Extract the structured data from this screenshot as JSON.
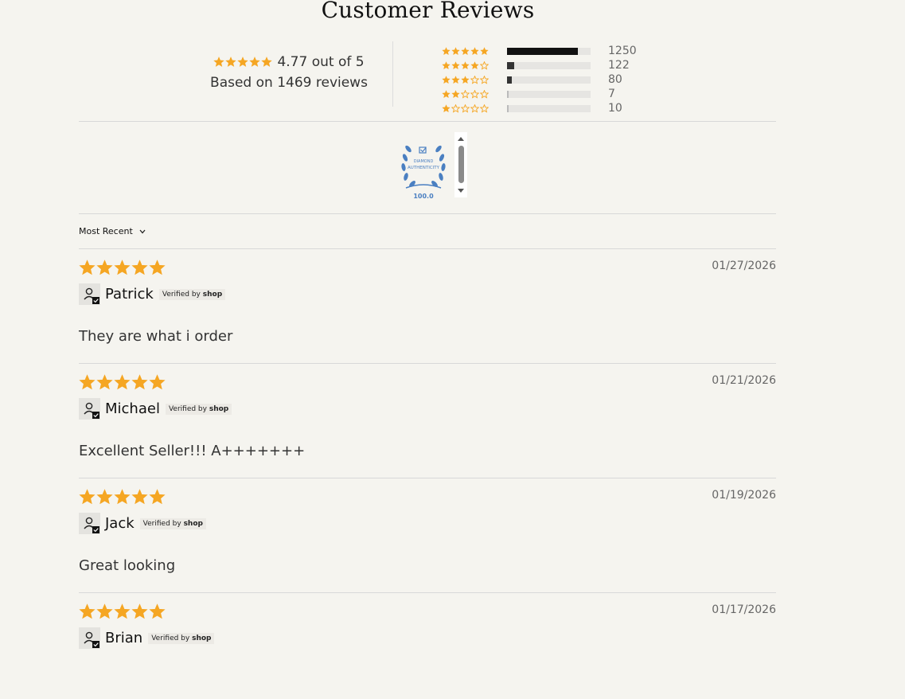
{
  "colors": {
    "star": "#f5a623",
    "bar_fill": "#111111",
    "bar_bg": "#e6e5e2",
    "background": "#f5f4ef"
  },
  "header": {
    "title": "Customer Reviews"
  },
  "summary": {
    "average_text": "4.77 out of 5",
    "based_on_text": "Based on 1469 reviews",
    "average_value": 4.77,
    "histogram": [
      {
        "stars": 5,
        "count": "1250",
        "fraction": 0.851
      },
      {
        "stars": 4,
        "count": "122",
        "fraction": 0.083
      },
      {
        "stars": 3,
        "count": "80",
        "fraction": 0.054
      },
      {
        "stars": 2,
        "count": "7",
        "fraction": 0.005
      },
      {
        "stars": 1,
        "count": "10",
        "fraction": 0.007
      }
    ]
  },
  "badge": {
    "label": "DIAMOND AUTHENTICITY",
    "score": "100.0",
    "icon": "laurel-badge-icon"
  },
  "sort": {
    "label": "Most Recent",
    "icon": "chevron-down-icon"
  },
  "reviews": [
    {
      "rating": 5,
      "date": "01/27/2026",
      "author": "Patrick",
      "verified_prefix": "Verified by",
      "verified_brand": "shop",
      "body": "They are what i order"
    },
    {
      "rating": 5,
      "date": "01/21/2026",
      "author": "Michael",
      "verified_prefix": "Verified by",
      "verified_brand": "shop",
      "body": "Excellent Seller!!! A+++++++"
    },
    {
      "rating": 5,
      "date": "01/19/2026",
      "author": "Jack",
      "verified_prefix": "Verified by",
      "verified_brand": "shop",
      "body": "Great looking"
    },
    {
      "rating": 5,
      "date": "01/17/2026",
      "author": "Brian",
      "verified_prefix": "Verified by",
      "verified_brand": "shop",
      "body": ""
    }
  ]
}
